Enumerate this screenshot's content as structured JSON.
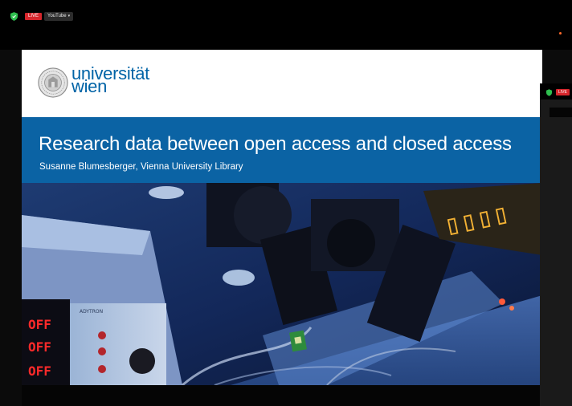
{
  "topbar": {
    "live_label": "LIVE",
    "menu_label": "YouTube",
    "menu_caret": "▾",
    "shield_icon": "shield-icon",
    "accent": "#d7262c"
  },
  "slide": {
    "logo_line1": "universität",
    "logo_line2": "wien",
    "title": "Research data between open access and closed access",
    "subtitle": "Susanne Blumesberger, Vienna University Library",
    "brand_color": "#0063a6",
    "band_color": "#0b63a4"
  },
  "photo": {
    "display_lines": [
      "OFF",
      "OFF",
      "OFF"
    ],
    "panel_label": "ADYTRON"
  },
  "secondary_window": {
    "live_label": "LIVE"
  }
}
